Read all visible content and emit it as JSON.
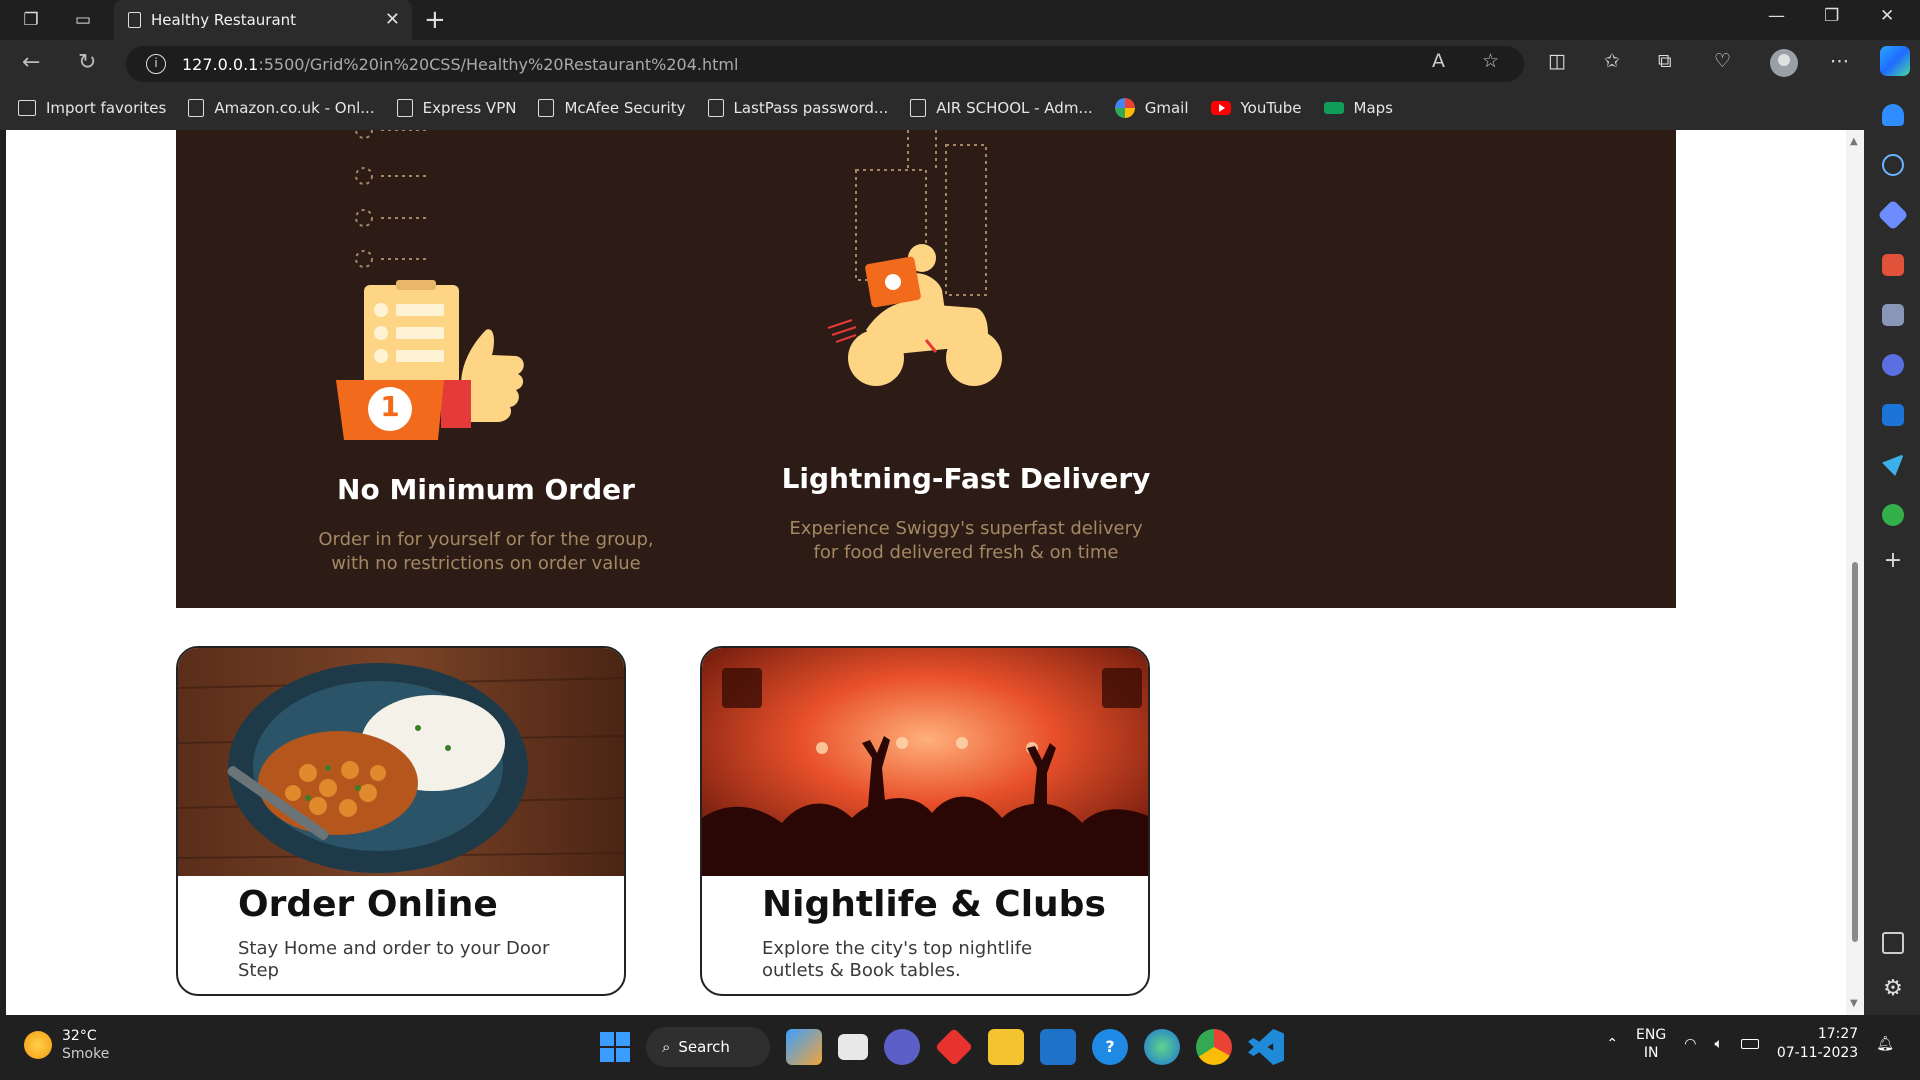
{
  "browser": {
    "tab_title": "Healthy Restaurant",
    "url_host": "127.0.0.1",
    "url_rest": ":5500/Grid%20in%20CSS/Healthy%20Restaurant%204.html",
    "favorites": [
      {
        "label": "Import favorites",
        "icon": "import-icon"
      },
      {
        "label": "Amazon.co.uk - Onl...",
        "icon": "page-icon"
      },
      {
        "label": "Express VPN",
        "icon": "page-icon"
      },
      {
        "label": "McAfee Security",
        "icon": "page-icon"
      },
      {
        "label": "LastPass password...",
        "icon": "page-icon"
      },
      {
        "label": "AIR SCHOOL - Adm...",
        "icon": "page-icon"
      },
      {
        "label": "Gmail",
        "icon": "google-icon"
      },
      {
        "label": "YouTube",
        "icon": "youtube-icon"
      },
      {
        "label": "Maps",
        "icon": "maps-icon"
      }
    ]
  },
  "features": [
    {
      "title": "No Minimum Order",
      "text_line1": "Order in for yourself or for the group,",
      "text_line2": "with no restrictions on order value",
      "badge": "1"
    },
    {
      "title": "Lightning-Fast Delivery",
      "text_line1": "Experience Swiggy's superfast delivery",
      "text_line2": "for food delivered fresh & on time"
    }
  ],
  "cards": [
    {
      "title": "Order Online",
      "text": "Stay Home and order to your Door Step"
    },
    {
      "title": "Nightlife & Clubs",
      "text": "Explore the city's top nightlife outlets & Book tables."
    }
  ],
  "taskbar": {
    "temperature": "32°C",
    "weather": "Smoke",
    "search_label": "Search",
    "lang": "ENG",
    "region": "IN",
    "time": "17:27",
    "date": "07-11-2023"
  },
  "colors": {
    "band": "#2c1c15",
    "feature_text": "#a48863",
    "accent_orange": "#f26b1d",
    "accent_yellow": "#fdd584"
  }
}
